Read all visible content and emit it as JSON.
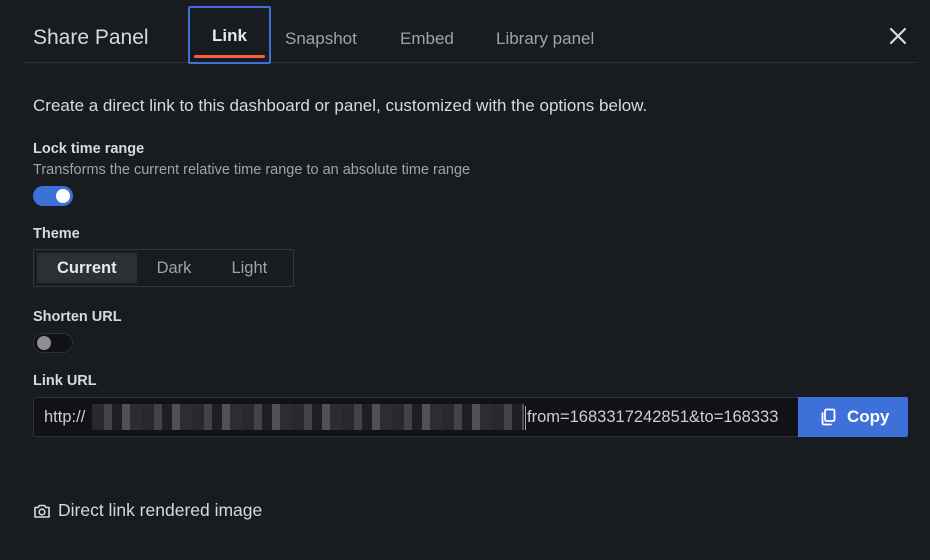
{
  "modal": {
    "title": "Share Panel",
    "close_icon": "close-icon"
  },
  "tabs": [
    {
      "label": "Link",
      "active": true
    },
    {
      "label": "Snapshot",
      "active": false
    },
    {
      "label": "Embed",
      "active": false
    },
    {
      "label": "Library panel",
      "active": false
    }
  ],
  "link_tab": {
    "description": "Create a direct link to this dashboard or panel, customized with the options below.",
    "lock_time_range": {
      "label": "Lock time range",
      "description": "Transforms the current relative time range to an absolute time range",
      "enabled": true
    },
    "theme": {
      "label": "Theme",
      "options": [
        "Current",
        "Dark",
        "Light"
      ],
      "selected": "Current"
    },
    "shorten_url": {
      "label": "Shorten URL",
      "enabled": false
    },
    "link_url": {
      "label": "Link URL",
      "prefix": "http://",
      "suffix": "from=1683317242851&to=168333"
    },
    "copy_button": {
      "label": "Copy",
      "icon": "copy-icon"
    },
    "rendered_image_link": {
      "label": "Direct link rendered image",
      "icon": "camera-icon"
    }
  },
  "colors": {
    "background": "#181b1f",
    "accent": "#3d71d9",
    "active_tab_underline": "#f55f3e"
  }
}
